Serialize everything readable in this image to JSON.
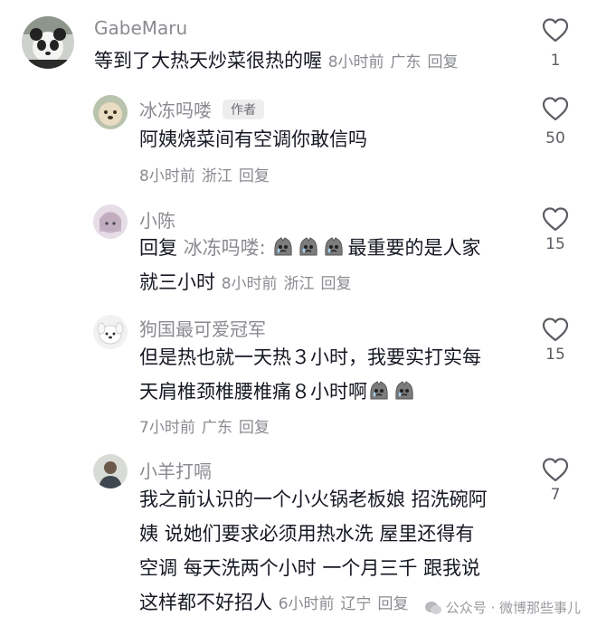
{
  "comments": [
    {
      "username": "GabeMaru",
      "text": "等到了大热天炒菜很热的喔",
      "time": "8小时前",
      "location": "广东",
      "reply": "回复",
      "likes": "1"
    },
    {
      "username": "冰冻吗喽",
      "badge": "作者",
      "text": "阿姨烧菜间有空调你敢信吗",
      "time": "8小时前",
      "location": "浙江",
      "reply": "回复",
      "likes": "50"
    },
    {
      "username": "小陈",
      "reply_prefix": "回复",
      "mention": "冰冻吗喽:",
      "text_a": "最重要的是人家",
      "text_b": "就三小时",
      "time": "8小时前",
      "location": "浙江",
      "reply": "回复",
      "likes": "15"
    },
    {
      "username": "狗国最可爱冠军",
      "line1": "但是热也就一天热３小时，我要实打实每",
      "line2": "天肩椎颈椎腰椎痛８小时啊",
      "time": "7小时前",
      "location": "广东",
      "reply": "回复",
      "likes": "15"
    },
    {
      "username": "小羊打嗝",
      "line1": "我之前认识的一个小火锅老板娘 招洗碗阿",
      "line2": "姨 说她们要求必须用热水洗 屋里还得有",
      "line3": "空调 每天洗两个小时 一个月三千 跟我说",
      "line4": "这样都不好招人",
      "time": "6小时前",
      "location": "辽宁",
      "reply": "回复",
      "likes": "7"
    }
  ],
  "watermark": "公众号 · 微博那些事儿",
  "icons": {
    "like": "heart-outline-icon",
    "emoji": "crying-face-emoji-icon"
  }
}
